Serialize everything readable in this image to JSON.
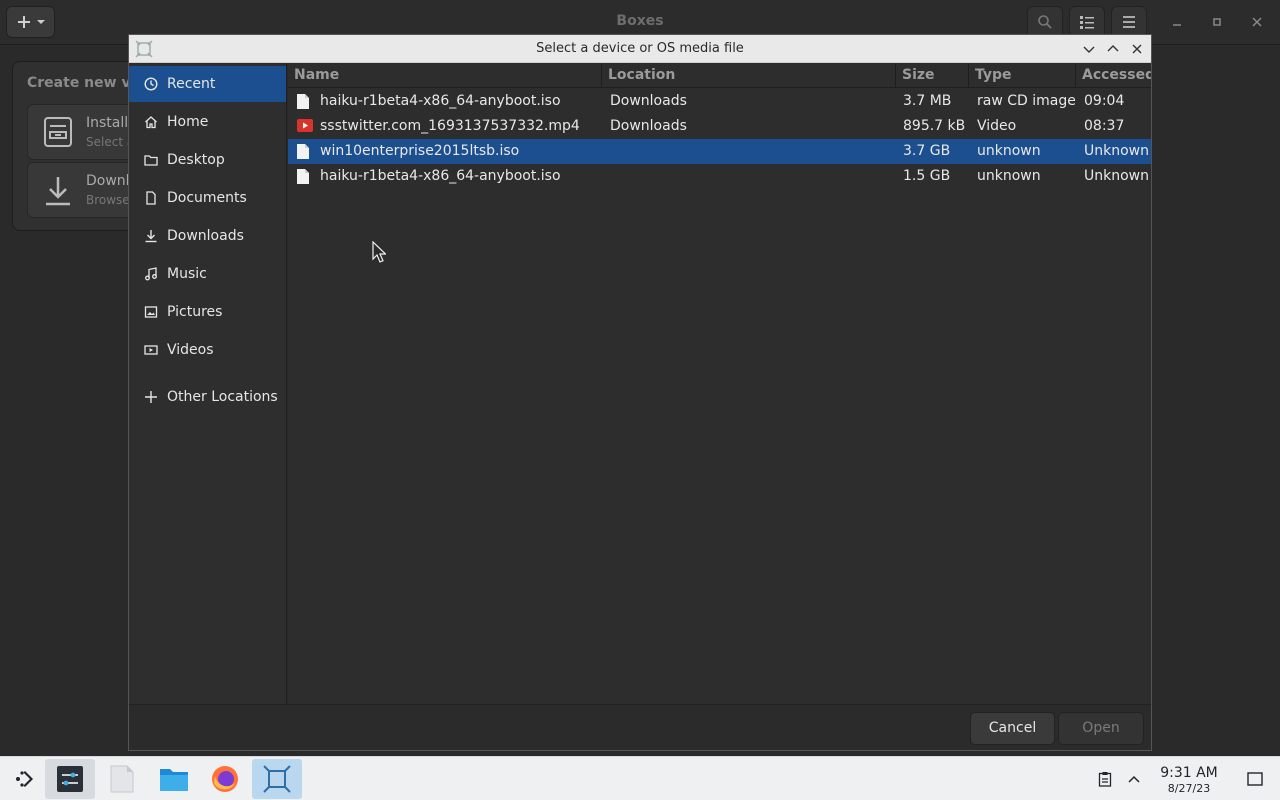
{
  "app": {
    "title": "Boxes",
    "popover": {
      "title": "Create new virt",
      "items": [
        {
          "title": "Install",
          "subtitle": "Select a",
          "icon": "archive-icon"
        },
        {
          "title": "Downl",
          "subtitle": "Browse",
          "icon": "download-icon"
        }
      ]
    }
  },
  "dialog": {
    "title": "Select a device or OS media file",
    "sidebar": [
      {
        "label": "Recent",
        "icon": "clock-icon",
        "active": true
      },
      {
        "label": "Home",
        "icon": "home-icon"
      },
      {
        "label": "Desktop",
        "icon": "folder-icon"
      },
      {
        "label": "Documents",
        "icon": "document-icon"
      },
      {
        "label": "Downloads",
        "icon": "download-icon"
      },
      {
        "label": "Music",
        "icon": "music-icon"
      },
      {
        "label": "Pictures",
        "icon": "pictures-icon"
      },
      {
        "label": "Videos",
        "icon": "video-icon"
      },
      {
        "label": "Other Locations",
        "icon": "plus-icon"
      }
    ],
    "columns": {
      "name": "Name",
      "location": "Location",
      "size": "Size",
      "type": "Type",
      "accessed": "Accessed"
    },
    "files": [
      {
        "name": "haiku-r1beta4-x86_64-anyboot.iso",
        "location": "Downloads",
        "size": "3.7 MB",
        "type": "raw CD image",
        "accessed": "09:04",
        "icon": "file-icon"
      },
      {
        "name": "ssstwitter.com_1693137537332.mp4",
        "location": "Downloads",
        "size": "895.7 kB",
        "type": "Video",
        "accessed": "08:37",
        "icon": "video-file-icon"
      },
      {
        "name": "win10enterprise2015ltsb.iso",
        "location": "",
        "size": "3.7 GB",
        "type": "unknown",
        "accessed": "Unknown",
        "icon": "file-icon",
        "selected": true
      },
      {
        "name": "haiku-r1beta4-x86_64-anyboot.iso",
        "location": "",
        "size": "1.5 GB",
        "type": "unknown",
        "accessed": "Unknown",
        "icon": "file-icon"
      }
    ],
    "buttons": {
      "cancel": "Cancel",
      "open": "Open"
    }
  },
  "taskbar": {
    "time": "9:31 AM",
    "date": "8/27/23"
  },
  "colors": {
    "selection": "#1c4f8f",
    "background": "#2a2a2a",
    "taskbar": "#eef0f2"
  }
}
